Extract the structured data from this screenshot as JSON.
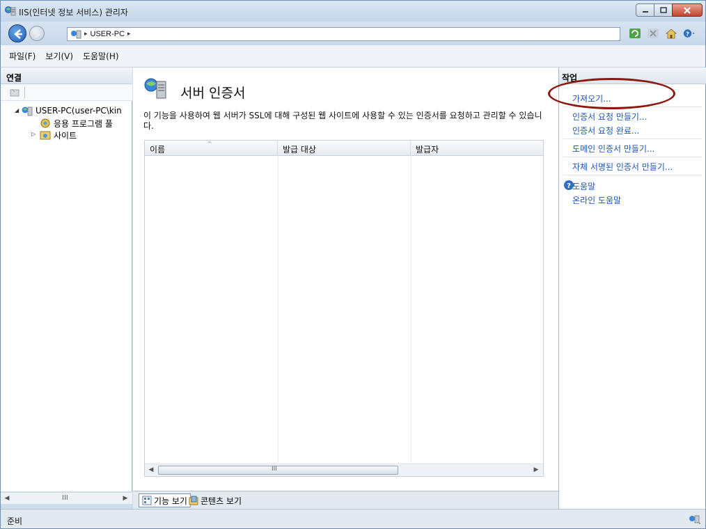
{
  "window": {
    "title": "IIS(인터넷 정보 서비스) 관리자"
  },
  "address": {
    "arrow": "▸",
    "segment": "USER-PC",
    "trailing_arrow": "▸"
  },
  "menu": [
    "파일(F)",
    "보기(V)",
    "도움말(H)"
  ],
  "connections": {
    "header": "연결",
    "tree": [
      {
        "label": "USER-PC(user-PC\\kin",
        "expander": "◢"
      },
      {
        "label": "응용 프로그램 풀"
      },
      {
        "label": "사이트",
        "expander": "▷"
      }
    ]
  },
  "main": {
    "title": "서버 인증서",
    "description": "이 기능을 사용하여 웹 서버가 SSL에 대해 구성된 웹 사이트에 사용할 수 있는 인증서를 요청하고 관리할 수 있습니다.",
    "columns": [
      "이름",
      "발급 대상",
      "발급자"
    ],
    "sort_glyph": "^",
    "scroll_grip": "III",
    "tabs": [
      "기능 보기",
      "콘텐츠 보기"
    ]
  },
  "actions": {
    "header": "작업",
    "items": [
      "가져오기...",
      "인증서 요청 만들기...",
      "인증서 요청 완료...",
      "도메인 인증서 만들기...",
      "자체 서명된 인증서 만들기...",
      "도움말",
      "온라인 도움말"
    ]
  },
  "status": {
    "text": "준비"
  },
  "colors": {
    "link": "#1e56b6",
    "highlight": "#8a1a10"
  }
}
